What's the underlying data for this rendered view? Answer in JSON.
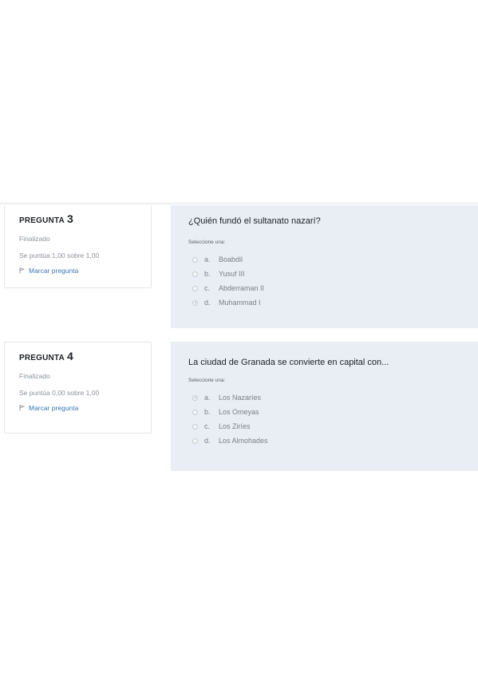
{
  "questions": [
    {
      "heading": "PREGUNTA",
      "number": "3",
      "state": "Finalizado",
      "grade": "Se puntúa 1,00 sobre 1,00",
      "flag_label": "Marcar pregunta",
      "flag_icon": "flag-icon",
      "question_text": "¿Quién fundó el sultanato nazarí?",
      "prompt": "Seleccione una:",
      "answers": [
        {
          "letter": "a.",
          "text": "Boabdil",
          "selected": false
        },
        {
          "letter": "b.",
          "text": "Yusuf III",
          "selected": false
        },
        {
          "letter": "c.",
          "text": "Abderraman II",
          "selected": false
        },
        {
          "letter": "d.",
          "text": "Muhammad I",
          "selected": true
        }
      ]
    },
    {
      "heading": "PREGUNTA",
      "number": "4",
      "state": "Finalizado",
      "grade": "Se puntúa 0,00 sobre 1,00",
      "flag_label": "Marcar pregunta",
      "flag_icon": "flag-icon",
      "question_text": "La ciudad de Granada se convierte en capital con...",
      "prompt": "Seleccione una:",
      "answers": [
        {
          "letter": "a.",
          "text": "Los Nazaríes",
          "selected": true
        },
        {
          "letter": "b.",
          "text": "Los Omeyas",
          "selected": false
        },
        {
          "letter": "c.",
          "text": "Los Ziríes",
          "selected": false
        },
        {
          "letter": "d.",
          "text": "Los Almohades",
          "selected": false
        }
      ]
    }
  ],
  "colors": {
    "panel_bg": "#e9edf4",
    "link": "#3a78b4",
    "muted_text": "#8c929a"
  }
}
